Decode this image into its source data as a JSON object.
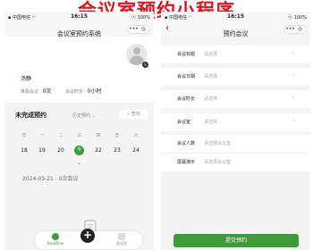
{
  "banner": {
    "title": "会议室预约小程序"
  },
  "left": {
    "status": {
      "carrier": "▪ 中国电信 ◠",
      "time": "16:15",
      "battery": "ⓢ 100%"
    },
    "nav": {
      "title": "会议室预约系统"
    },
    "profile": {
      "username": "汤静",
      "meetings_label": "某般会议",
      "meetings_value": "0次",
      "duration_label": "会议时长",
      "duration_value": "0小时"
    },
    "section": {
      "title": "未完成预约",
      "history": "历史预约 ⌄",
      "search": "⌕ 查询"
    },
    "weekdays": [
      "日",
      "一",
      "二",
      "三",
      "四",
      "五",
      "六"
    ],
    "dates": [
      "18",
      "19",
      "20",
      "21",
      "22",
      "23",
      "24"
    ],
    "selected_date": "今",
    "record": "2024-03-21 · 0次会议",
    "tabbar": {
      "home": "Bookflow",
      "room": "会议室"
    }
  },
  "right": {
    "status": {
      "carrier": "▪ 中国电信 ◠",
      "time": "16:15",
      "battery": "ⓢ 100%"
    },
    "nav": {
      "title": "预约会议"
    },
    "form": {
      "rows": [
        {
          "label": "会议标题",
          "value": "请选择",
          "arrow": "›"
        },
        {
          "label": "会议日期",
          "value": "请选择",
          "arrow": "›"
        },
        {
          "label": "会议时长",
          "value": "请选择",
          "arrow": "›"
        },
        {
          "label": "会议室",
          "value": "请选择",
          "arrow": "›"
        },
        {
          "label": "会议人数",
          "value": "请选择会议室",
          "arrow": ""
        },
        {
          "label": "屏幕演示",
          "value": "请选择会议室",
          "arrow": ""
        }
      ]
    },
    "submit": "提交预约"
  },
  "colors": {
    "accent": "#3e9b3a",
    "banner": "#e0141c"
  }
}
